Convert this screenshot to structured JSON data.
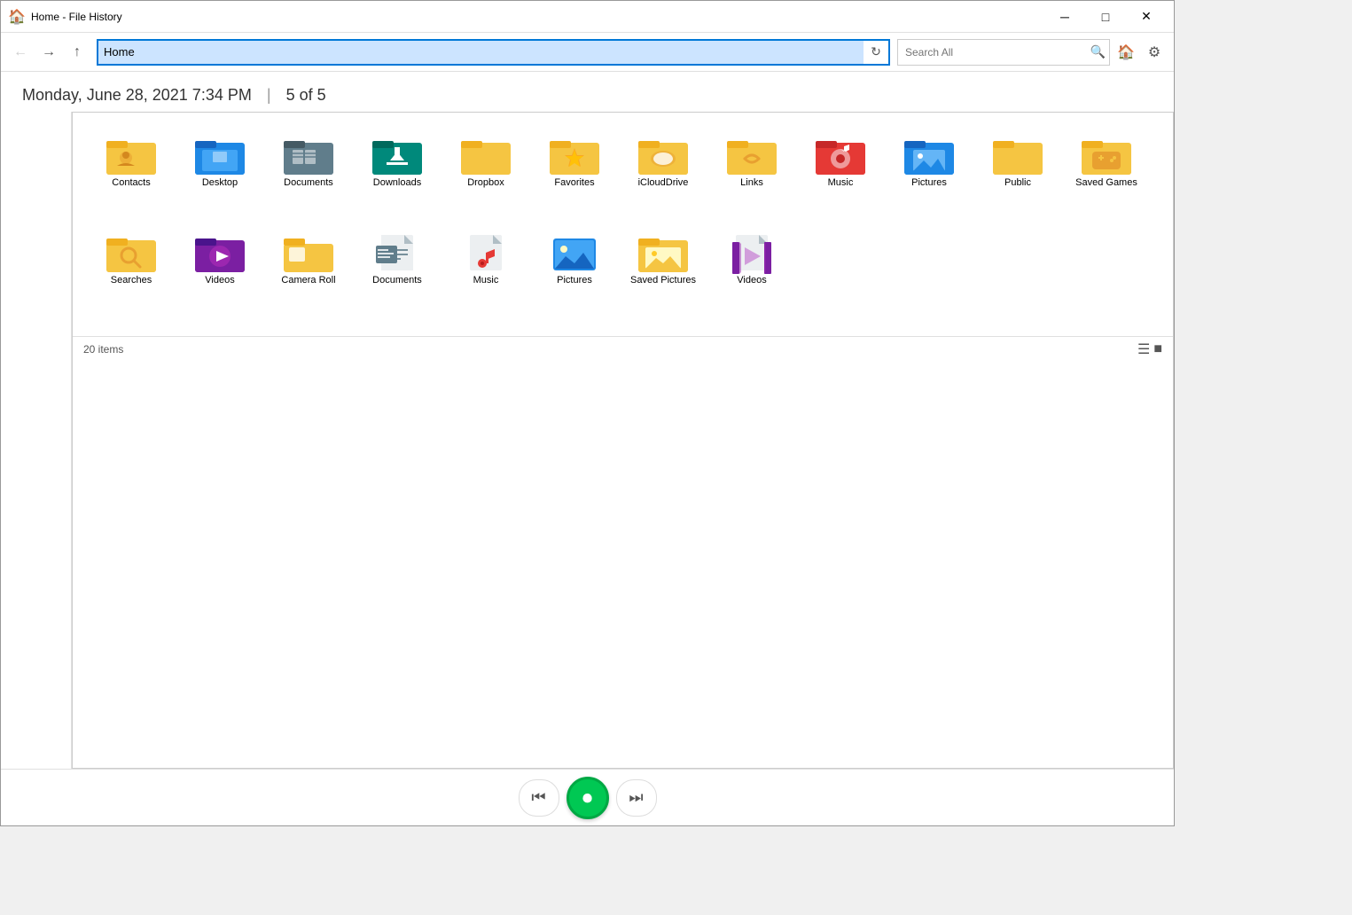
{
  "window": {
    "title": "Home - File History",
    "icon": "🏠"
  },
  "titlebar": {
    "minimize_label": "─",
    "maximize_label": "□",
    "close_label": "✕"
  },
  "navbar": {
    "back_title": "Back",
    "forward_title": "Forward",
    "up_title": "Up",
    "address_value": "Home",
    "address_placeholder": "Home",
    "search_placeholder": "Search All",
    "home_title": "Home",
    "settings_title": "Settings"
  },
  "datebar": {
    "date": "Monday, June 28, 2021 7:34 PM",
    "separator": "|",
    "version": "5 of 5"
  },
  "files": [
    {
      "name": "Contacts",
      "type": "contacts"
    },
    {
      "name": "Desktop",
      "type": "desktop"
    },
    {
      "name": "Documents",
      "type": "documents"
    },
    {
      "name": "Downloads",
      "type": "downloads"
    },
    {
      "name": "Dropbox",
      "type": "dropbox"
    },
    {
      "name": "Favorites",
      "type": "favorites"
    },
    {
      "name": "iCloudDrive",
      "type": "icloud"
    },
    {
      "name": "Links",
      "type": "links"
    },
    {
      "name": "Music",
      "type": "music"
    },
    {
      "name": "Pictures",
      "type": "pictures"
    },
    {
      "name": "Public",
      "type": "public"
    },
    {
      "name": "Saved Games",
      "type": "savedgames"
    },
    {
      "name": "Searches",
      "type": "searches"
    },
    {
      "name": "Videos",
      "type": "videos"
    },
    {
      "name": "Camera Roll",
      "type": "cameraroll"
    },
    {
      "name": "Documents",
      "type": "documents-file"
    },
    {
      "name": "Music",
      "type": "music-file"
    },
    {
      "name": "Pictures",
      "type": "pictures-file"
    },
    {
      "name": "Saved Pictures",
      "type": "savedpictures"
    },
    {
      "name": "Videos",
      "type": "videos-file"
    }
  ],
  "statusbar": {
    "item_count": "20 items"
  },
  "playback": {
    "prev_label": "⏮",
    "play_label": "⏺",
    "next_label": "⏭"
  }
}
